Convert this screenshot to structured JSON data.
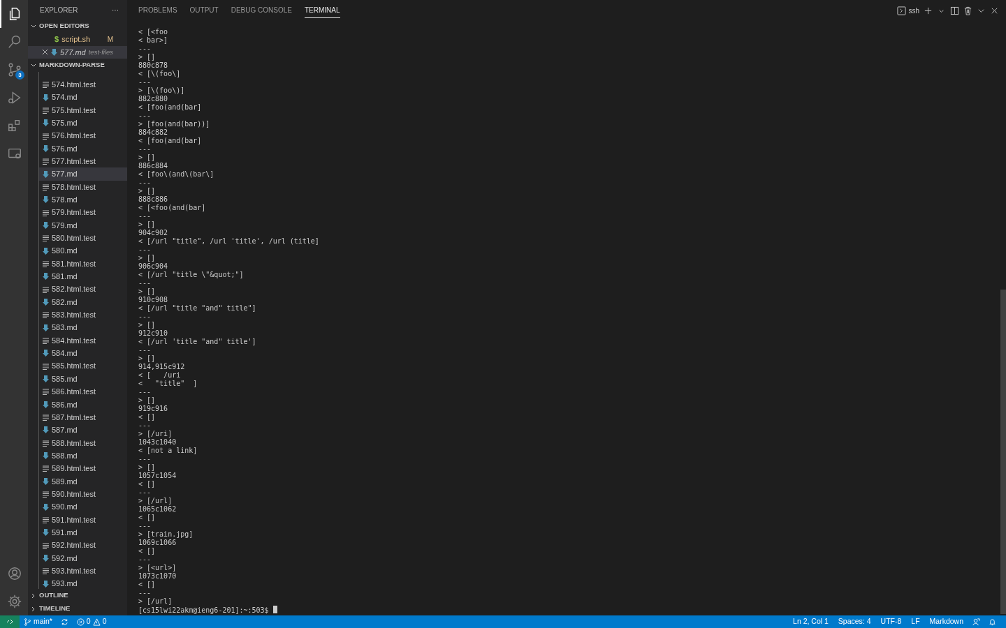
{
  "activity_bar": {
    "items": [
      {
        "kind": "files",
        "selected": true
      },
      {
        "kind": "search",
        "selected": false
      },
      {
        "kind": "source-control",
        "selected": false,
        "badge": "3"
      },
      {
        "kind": "run",
        "selected": false
      },
      {
        "kind": "extensions",
        "selected": false
      },
      {
        "kind": "remote",
        "selected": false
      }
    ],
    "bottom": [
      {
        "kind": "account"
      },
      {
        "kind": "settings"
      }
    ]
  },
  "sidebar": {
    "title": "EXPLORER",
    "more": "···",
    "open_editors": {
      "title": "OPEN EDITORS",
      "expanded": true,
      "items": [
        {
          "name": "script.sh",
          "kind": "shell",
          "icon": "$",
          "badge": "M",
          "selected": false
        },
        {
          "name": "577.md",
          "kind": "markdown",
          "description": "test-files",
          "selected": true
        }
      ]
    },
    "folder": {
      "title": "MARKDOWN-PARSE",
      "expanded": true,
      "items": [
        {
          "name": "574.html.test",
          "kind": "text",
          "selected": false
        },
        {
          "name": "574.md",
          "kind": "markdown",
          "selected": false
        },
        {
          "name": "575.html.test",
          "kind": "text",
          "selected": false
        },
        {
          "name": "575.md",
          "kind": "markdown",
          "selected": false
        },
        {
          "name": "576.html.test",
          "kind": "text",
          "selected": false
        },
        {
          "name": "576.md",
          "kind": "markdown",
          "selected": false
        },
        {
          "name": "577.html.test",
          "kind": "text",
          "selected": false
        },
        {
          "name": "577.md",
          "kind": "markdown",
          "selected": true
        },
        {
          "name": "578.html.test",
          "kind": "text",
          "selected": false
        },
        {
          "name": "578.md",
          "kind": "markdown",
          "selected": false
        },
        {
          "name": "579.html.test",
          "kind": "text",
          "selected": false
        },
        {
          "name": "579.md",
          "kind": "markdown",
          "selected": false
        },
        {
          "name": "580.html.test",
          "kind": "text",
          "selected": false
        },
        {
          "name": "580.md",
          "kind": "markdown",
          "selected": false
        },
        {
          "name": "581.html.test",
          "kind": "text",
          "selected": false
        },
        {
          "name": "581.md",
          "kind": "markdown",
          "selected": false
        },
        {
          "name": "582.html.test",
          "kind": "text",
          "selected": false
        },
        {
          "name": "582.md",
          "kind": "markdown",
          "selected": false
        },
        {
          "name": "583.html.test",
          "kind": "text",
          "selected": false
        },
        {
          "name": "583.md",
          "kind": "markdown",
          "selected": false
        },
        {
          "name": "584.html.test",
          "kind": "text",
          "selected": false
        },
        {
          "name": "584.md",
          "kind": "markdown",
          "selected": false
        },
        {
          "name": "585.html.test",
          "kind": "text",
          "selected": false
        },
        {
          "name": "585.md",
          "kind": "markdown",
          "selected": false
        },
        {
          "name": "586.html.test",
          "kind": "text",
          "selected": false
        },
        {
          "name": "586.md",
          "kind": "markdown",
          "selected": false
        },
        {
          "name": "587.html.test",
          "kind": "text",
          "selected": false
        },
        {
          "name": "587.md",
          "kind": "markdown",
          "selected": false
        },
        {
          "name": "588.html.test",
          "kind": "text",
          "selected": false
        },
        {
          "name": "588.md",
          "kind": "markdown",
          "selected": false
        },
        {
          "name": "589.html.test",
          "kind": "text",
          "selected": false
        },
        {
          "name": "589.md",
          "kind": "markdown",
          "selected": false
        },
        {
          "name": "590.html.test",
          "kind": "text",
          "selected": false
        },
        {
          "name": "590.md",
          "kind": "markdown",
          "selected": false
        },
        {
          "name": "591.html.test",
          "kind": "text",
          "selected": false
        },
        {
          "name": "591.md",
          "kind": "markdown",
          "selected": false
        },
        {
          "name": "592.html.test",
          "kind": "text",
          "selected": false
        },
        {
          "name": "592.md",
          "kind": "markdown",
          "selected": false
        },
        {
          "name": "593.html.test",
          "kind": "text",
          "selected": false
        },
        {
          "name": "593.md",
          "kind": "markdown",
          "selected": false
        }
      ]
    },
    "sections": [
      {
        "title": "OUTLINE",
        "expanded": false
      },
      {
        "title": "TIMELINE",
        "expanded": false
      }
    ]
  },
  "panel": {
    "tabs": [
      {
        "label": "PROBLEMS",
        "selected": false
      },
      {
        "label": "OUTPUT",
        "selected": false
      },
      {
        "label": "DEBUG CONSOLE",
        "selected": false
      },
      {
        "label": "TERMINAL",
        "selected": true
      }
    ],
    "terminal_name": "ssh",
    "terminal_lines": [
      "< [<foo",
      "< bar>]",
      "---",
      "> []",
      "880c878",
      "< [\\(foo\\]",
      "---",
      "> [\\(foo\\)]",
      "882c880",
      "< [foo(and(bar]",
      "---",
      "> [foo(and(bar))]",
      "884c882",
      "< [foo(and(bar]",
      "---",
      "> []",
      "886c884",
      "< [foo\\(and\\(bar\\]",
      "---",
      "> []",
      "888c886",
      "< [<foo(and(bar]",
      "---",
      "> []",
      "904c902",
      "< [/url \"title\", /url 'title', /url (title]",
      "---",
      "> []",
      "906c904",
      "< [/url \"title \\\"&quot;\"]",
      "---",
      "> []",
      "910c908",
      "< [/url \"title \"and\" title\"]",
      "---",
      "> []",
      "912c910",
      "< [/url 'title \"and\" title']",
      "---",
      "> []",
      "914,915c912",
      "< [   /uri",
      "<   \"title\"  ]",
      "---",
      "> []",
      "919c916",
      "< []",
      "---",
      "> [/uri]",
      "1043c1040",
      "< [not a link]",
      "---",
      "> []",
      "1057c1054",
      "< []",
      "---",
      "> [/url]",
      "1065c1062",
      "< []",
      "---",
      "> [train.jpg]",
      "1069c1066",
      "< []",
      "---",
      "> [<url>]",
      "1073c1070",
      "< []",
      "---",
      "> [/url]"
    ],
    "prompt": "[cs15lwi22akm@ieng6-201]:~:503$"
  },
  "status_bar": {
    "branch": "main*",
    "errors": "0",
    "warnings": "0",
    "right": [
      "Ln 2, Col 1",
      "Spaces: 4",
      "UTF-8",
      "LF",
      "Markdown"
    ]
  }
}
